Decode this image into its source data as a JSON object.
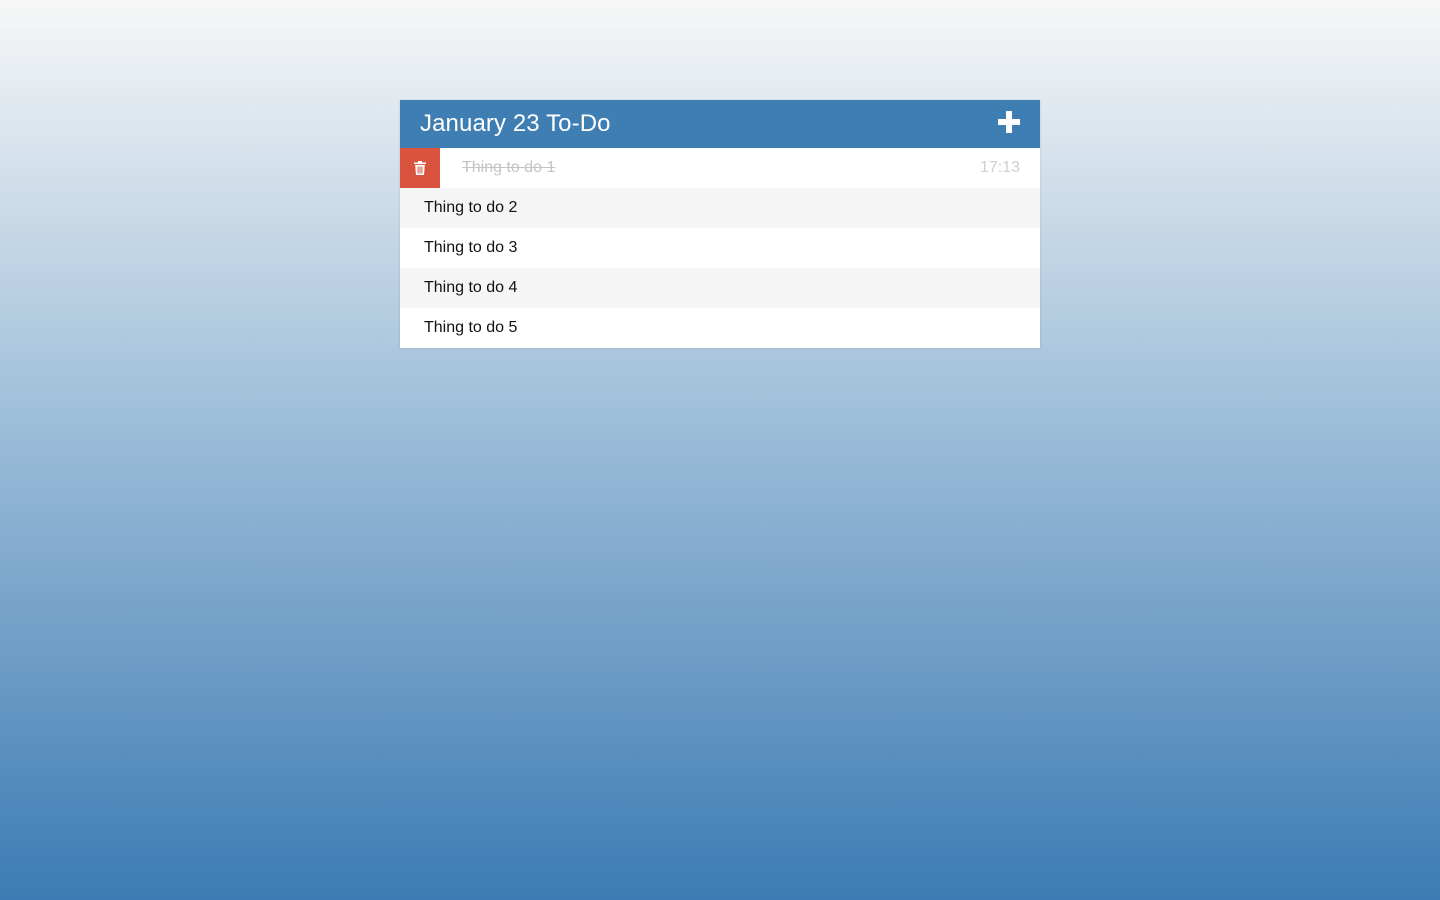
{
  "header": {
    "title": "January 23 To-Do",
    "add_icon": "plus-icon"
  },
  "todos": [
    {
      "text": "Thing to do 1",
      "completed": true,
      "time": "17:13",
      "delete_icon": "trash-icon"
    },
    {
      "text": "Thing to do 2",
      "completed": false
    },
    {
      "text": "Thing to do 3",
      "completed": false
    },
    {
      "text": "Thing to do 4",
      "completed": false
    },
    {
      "text": "Thing to do 5",
      "completed": false
    }
  ],
  "colors": {
    "header_bg": "#3f7eb2",
    "delete_bg": "#d9533f",
    "background_top": "#f7f7f7",
    "background_bottom": "#3c7bb3"
  }
}
